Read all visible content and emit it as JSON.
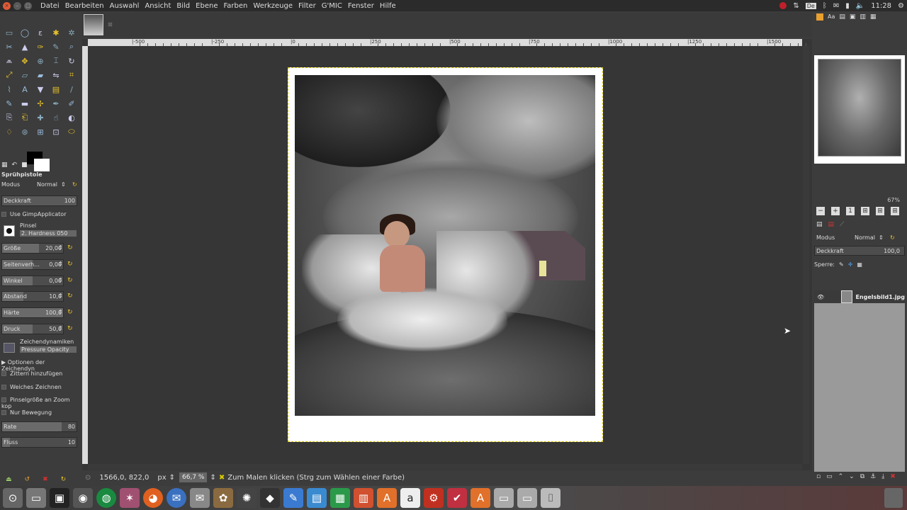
{
  "menubar": {
    "items": [
      "Datei",
      "Bearbeiten",
      "Auswahl",
      "Ansicht",
      "Bild",
      "Ebene",
      "Farben",
      "Werkzeuge",
      "Filter",
      "G'MIC",
      "Fenster",
      "Hilfe"
    ],
    "lang": "De",
    "clock": "11:28"
  },
  "toolbox": {
    "icons": [
      "rect-select-icon",
      "ellipse-select-icon",
      "lasso-icon",
      "fuzzy-select-icon",
      "select-by-color-icon",
      "scissors-icon",
      "foreground-select-icon",
      "paths-icon",
      "color-picker-icon",
      "zoom-icon",
      "measure-icon",
      "move-icon",
      "align-icon",
      "crop-icon",
      "rotate-icon",
      "scale-icon",
      "shear-icon",
      "perspective-icon",
      "flip-icon",
      "cage-icon",
      "warp-icon",
      "text-icon",
      "bucket-fill-icon",
      "blend-icon",
      "pencil-icon",
      "paintbrush-icon",
      "eraser-icon",
      "airbrush-icon",
      "ink-icon",
      "mypaint-icon",
      "clone-icon",
      "perspective-clone-icon",
      "heal-icon",
      "smudge-icon",
      "dodge-burn-icon",
      "blur-icon",
      "gegl-icon",
      "unified-transform-icon",
      "handle-transform-icon",
      "colorize-icon"
    ],
    "tool_name": "Sprühpistole",
    "mode_label": "Modus",
    "mode_value": "Normal",
    "opacity": {
      "label": "Deckkraft",
      "value": "100"
    },
    "use_gimpapplicator": "Use GimpApplicator",
    "brush_label": "Pinsel",
    "brush_value": "2. Hardness 050",
    "sliders": [
      {
        "label": "Größe",
        "value": "20,00",
        "fill": 0.6
      },
      {
        "label": "Seitenverh...",
        "value": "0,00",
        "fill": 0.5
      },
      {
        "label": "Winkel",
        "value": "0,00",
        "fill": 0.5
      },
      {
        "label": "Abstand",
        "value": "10,0",
        "fill": 0.35
      },
      {
        "label": "Härte",
        "value": "100,0",
        "fill": 1.0
      },
      {
        "label": "Druck",
        "value": "50,0",
        "fill": 0.5
      }
    ],
    "dynamics_label": "Zeichendynamiken",
    "dynamics_value": "Pressure Opacity",
    "dynamics_options": "Optionen der Zeichendyn",
    "jitter": "Zittern hinzufügen",
    "smooth": "Weiches Zeichnen",
    "brush_zoom": "Pinselgröße an Zoom kop",
    "incremental": "Nur Bewegung",
    "rate": {
      "label": "Rate",
      "value": "80",
      "fill": 0.8
    },
    "flow": {
      "label": "Fluss",
      "value": "10",
      "fill": 0.1
    }
  },
  "ruler": {
    "labels": [
      "|-500",
      "|-250",
      "|0",
      "|250",
      "|500",
      "|750",
      "|1000",
      "|1250",
      "|1500"
    ]
  },
  "status": {
    "coords": "1566,0, 822,0",
    "unit": "px",
    "zoom": "66,7 %",
    "message": "Zum Malen klicken (Strg zum Wählen einer Farbe)"
  },
  "dock": {
    "zoom": "67%",
    "mode_label": "Modus",
    "mode_value": "Normal",
    "opacity_label": "Deckkraft",
    "opacity_value": "100,0",
    "lock_label": "Sperre:",
    "layer_name": "Engelsbild1.jpg"
  },
  "colors": {
    "accent_yellow": "#e8c22a",
    "close_red": "#e05a36"
  }
}
